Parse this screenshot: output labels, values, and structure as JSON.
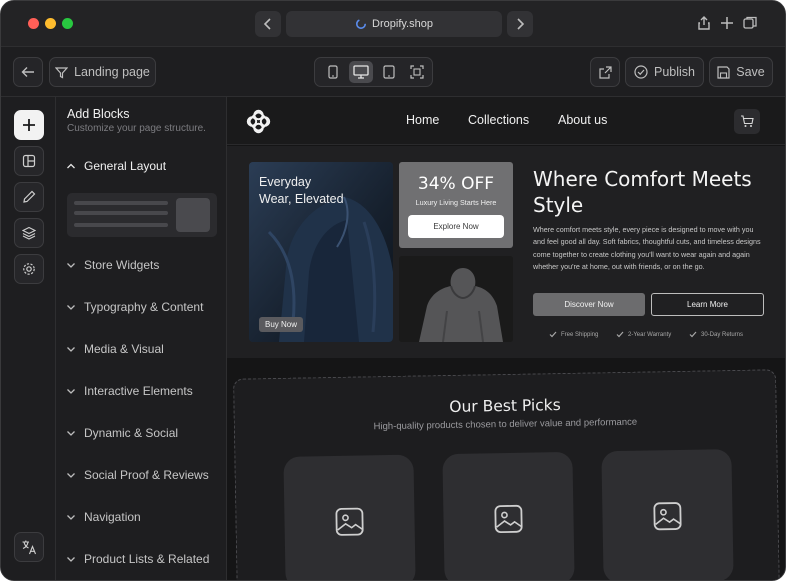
{
  "browser": {
    "url": "Dropify.shop"
  },
  "toolbar": {
    "page_label": "Landing page",
    "publish_label": "Publish",
    "save_label": "Save"
  },
  "blocks_panel": {
    "title": "Add Blocks",
    "subtitle": "Customize your page structure.",
    "categories": [
      {
        "label": "General Layout",
        "expanded": true
      },
      {
        "label": "Store Widgets",
        "expanded": false
      },
      {
        "label": "Typography & Content",
        "expanded": false
      },
      {
        "label": "Media & Visual",
        "expanded": false
      },
      {
        "label": "Interactive Elements",
        "expanded": false
      },
      {
        "label": "Dynamic & Social",
        "expanded": false
      },
      {
        "label": "Social Proof & Reviews",
        "expanded": false
      },
      {
        "label": "Navigation",
        "expanded": false
      },
      {
        "label": "Product Lists & Related",
        "expanded": false
      }
    ]
  },
  "site": {
    "nav": {
      "links": [
        "Home",
        "Collections",
        "About us"
      ]
    },
    "hero": {
      "image_caption": "Everyday\nWear, Elevated",
      "buy_now": "Buy Now",
      "promo_headline": "34% OFF",
      "promo_sub": "Luxury Living Starts Here",
      "promo_button": "Explore Now",
      "title": "Where Comfort Meets Style",
      "description": "Where comfort meets style, every piece is designed to move with you and feel good all day. Soft fabrics, thoughtful cuts, and timeless designs come together to create clothing you'll want to wear again and again whether you're at home, out with friends, or on the go.",
      "primary_button": "Discover Now",
      "secondary_button": "Learn More",
      "features": [
        "Free Shipping",
        "2-Year Warranty",
        "30-Day Returns"
      ]
    },
    "picks": {
      "title": "Our Best Picks",
      "subtitle": "High-quality products chosen to deliver value and performance"
    }
  },
  "colors": {
    "window_bg": "#1b1b1d",
    "canvas_bg": "#151516",
    "accent_light": "#f2f2f2",
    "traffic_red": "#ff5f57",
    "traffic_yellow": "#febc2e",
    "traffic_green": "#28c840"
  }
}
